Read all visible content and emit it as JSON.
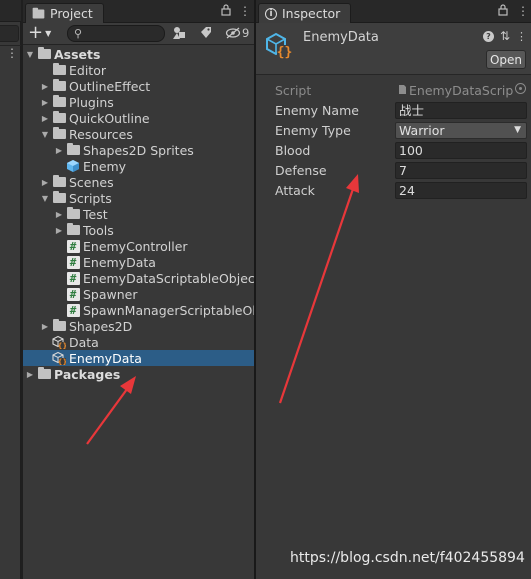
{
  "project": {
    "tab_label": "Project",
    "add_symbol": "+",
    "search_placeholder": "",
    "hidden_count": "9",
    "tree": [
      {
        "label": "Assets",
        "depth": 0,
        "arrow": "open",
        "icon": "folder-icon",
        "bold": true
      },
      {
        "label": "Editor",
        "depth": 1,
        "arrow": "none",
        "icon": "folder-icon"
      },
      {
        "label": "OutlineEffect",
        "depth": 1,
        "arrow": "closed",
        "icon": "folder-icon"
      },
      {
        "label": "Plugins",
        "depth": 1,
        "arrow": "closed",
        "icon": "folder-icon"
      },
      {
        "label": "QuickOutline",
        "depth": 1,
        "arrow": "closed",
        "icon": "folder-icon"
      },
      {
        "label": "Resources",
        "depth": 1,
        "arrow": "open",
        "icon": "folder-icon"
      },
      {
        "label": "Shapes2D Sprites",
        "depth": 2,
        "arrow": "closed",
        "icon": "folder-icon"
      },
      {
        "label": "Enemy",
        "depth": 2,
        "arrow": "none",
        "icon": "prefab-cube-icon"
      },
      {
        "label": "Scenes",
        "depth": 1,
        "arrow": "closed",
        "icon": "folder-icon"
      },
      {
        "label": "Scripts",
        "depth": 1,
        "arrow": "open",
        "icon": "folder-icon"
      },
      {
        "label": "Test",
        "depth": 2,
        "arrow": "closed",
        "icon": "folder-icon"
      },
      {
        "label": "Tools",
        "depth": 2,
        "arrow": "closed",
        "icon": "folder-icon"
      },
      {
        "label": "EnemyController",
        "depth": 2,
        "arrow": "none",
        "icon": "csharp-script-icon"
      },
      {
        "label": "EnemyData",
        "depth": 2,
        "arrow": "none",
        "icon": "csharp-script-icon"
      },
      {
        "label": "EnemyDataScriptableObject",
        "depth": 2,
        "arrow": "none",
        "icon": "csharp-script-icon"
      },
      {
        "label": "Spawner",
        "depth": 2,
        "arrow": "none",
        "icon": "csharp-script-icon"
      },
      {
        "label": "SpawnManagerScriptableObje",
        "depth": 2,
        "arrow": "none",
        "icon": "csharp-script-icon"
      },
      {
        "label": "Shapes2D",
        "depth": 1,
        "arrow": "closed",
        "icon": "folder-icon"
      },
      {
        "label": "Data",
        "depth": 1,
        "arrow": "none",
        "icon": "scriptable-object-icon"
      },
      {
        "label": "EnemyData",
        "depth": 1,
        "arrow": "none",
        "icon": "scriptable-object-icon",
        "selected": true
      },
      {
        "label": "Packages",
        "depth": 0,
        "arrow": "closed",
        "icon": "folder-icon",
        "bold": true
      }
    ]
  },
  "inspector": {
    "tab_label": "Inspector",
    "asset_name": "EnemyData",
    "open_button": "Open",
    "properties": [
      {
        "label": "Script",
        "value": "EnemyDataScrip",
        "kind": "script"
      },
      {
        "label": "Enemy Name",
        "value": "战士",
        "kind": "text"
      },
      {
        "label": "Enemy Type",
        "value": "Warrior",
        "kind": "dropdown"
      },
      {
        "label": "Blood",
        "value": "100",
        "kind": "text"
      },
      {
        "label": "Defense",
        "value": "7",
        "kind": "text"
      },
      {
        "label": "Attack",
        "value": "24",
        "kind": "text"
      }
    ]
  },
  "watermark": "https://blog.csdn.net/f402455894",
  "colors": {
    "selection": "#2c5d87",
    "panel_bg": "#383838",
    "annotation_arrow": "#e8373a"
  }
}
